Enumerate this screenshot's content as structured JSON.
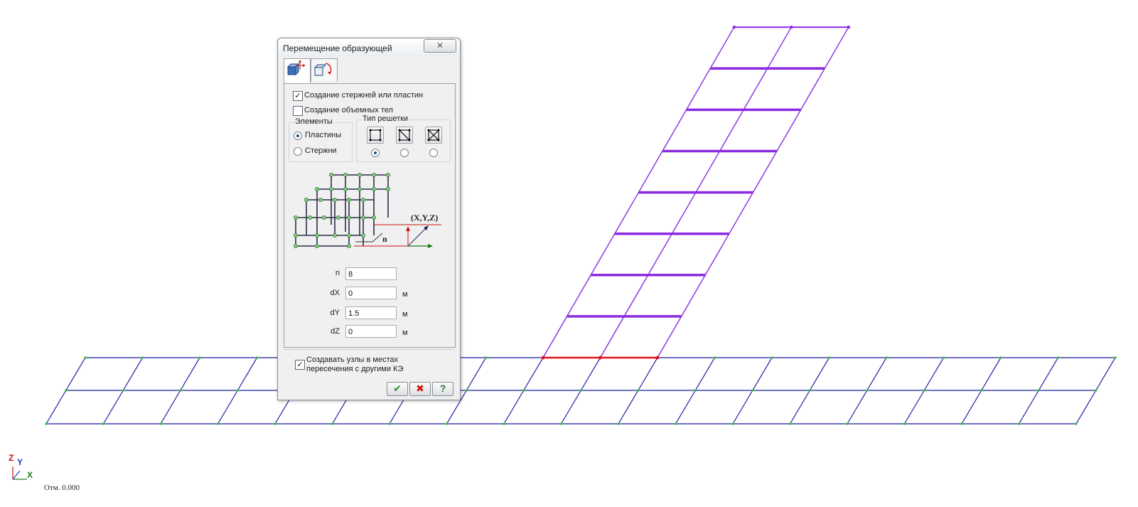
{
  "dialog": {
    "title": "Перемещение образующей",
    "close_icon": "x-close-icon",
    "tabs": [
      {
        "icon": "move-axes-icon",
        "active": true
      },
      {
        "icon": "rotate-block-icon",
        "active": false
      }
    ],
    "options": {
      "create_bars_plates": {
        "label": "Создание стержней или пластин",
        "checked": true
      },
      "create_solids": {
        "label": "Создание объемных тел",
        "checked": false
      }
    },
    "elements_group": {
      "title": "Элементы",
      "options": [
        {
          "label": "Пластины",
          "selected": true
        },
        {
          "label": "Стержни",
          "selected": false
        }
      ]
    },
    "lattice_group": {
      "title": "Тип решетки",
      "selected_index": 0,
      "types": [
        "lattice-square-icon",
        "lattice-diagonal-icon",
        "lattice-cross-icon"
      ]
    },
    "illustration": {
      "coord_label": "(X,Y,Z)",
      "n_label": "n"
    },
    "fields": [
      {
        "label": "n",
        "value": "8",
        "unit": ""
      },
      {
        "label": "dX",
        "value": "0",
        "unit": "м"
      },
      {
        "label": "dY",
        "value": "1.5",
        "unit": "м"
      },
      {
        "label": "dZ",
        "value": "0",
        "unit": "м"
      }
    ],
    "create_nodes": {
      "label_line1": "Создавать узлы в местах",
      "label_line2": "пересечения с другими КЭ",
      "checked": true
    },
    "buttons": {
      "ok_icon": "check-icon",
      "cancel_icon": "red-x-icon",
      "help_label": "?"
    }
  },
  "axes_indicator": {
    "z": "Z",
    "y": "Y",
    "x": "X"
  },
  "elevation_label": "Отм. 0.000",
  "colors": {
    "mesh": "#1a1aa0",
    "generated": "#8a2be2",
    "generatrix": "#e0101a",
    "node": "#38c038"
  }
}
